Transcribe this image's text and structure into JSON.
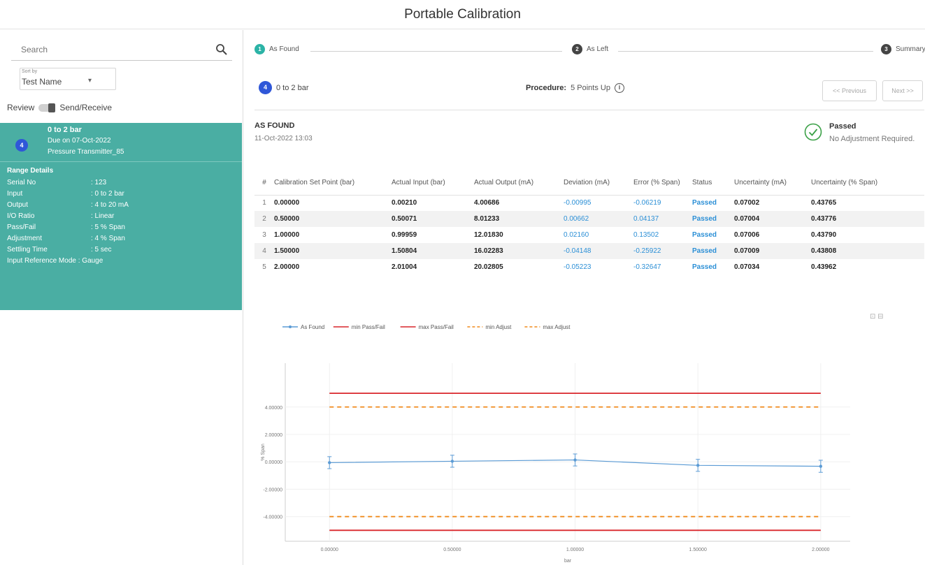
{
  "app_title": "Portable Calibration",
  "sidebar": {
    "search_placeholder": "Search",
    "sort": {
      "caption": "Sort by",
      "value": "Test Name"
    },
    "review": {
      "left": "Review",
      "right": "Send/Receive"
    },
    "card": {
      "badge": "4",
      "title": "0 to 2 bar",
      "due": "Due on 07-Oct-2022",
      "type": "Pressure Transmitter_85",
      "range_title": "Range Details",
      "details": [
        {
          "k": "Serial No",
          "v": ": 123"
        },
        {
          "k": "Input",
          "v": ": 0 to 2 bar"
        },
        {
          "k": "Output",
          "v": ": 4 to 20 mA"
        },
        {
          "k": "I/O Ratio",
          "v": ": Linear"
        },
        {
          "k": "Pass/Fail",
          "v": ": 5 % Span"
        },
        {
          "k": "Adjustment",
          "v": ": 4 % Span"
        },
        {
          "k": "Settling Time",
          "v": ": 5 sec"
        }
      ],
      "ref_mode": "Input Reference Mode : Gauge"
    }
  },
  "stepper": {
    "steps": [
      {
        "num": "1",
        "label": "As Found",
        "color": "#2bb3a6"
      },
      {
        "num": "2",
        "label": "As Left",
        "color": "#444444"
      },
      {
        "num": "3",
        "label": "Summary",
        "color": "#444444"
      }
    ]
  },
  "subheader": {
    "badge": "4",
    "range": "0 to 2 bar",
    "procedure_label": "Procedure:",
    "procedure_value": "5 Points Up",
    "prev_label": "<< Previous",
    "next_label": "Next >>"
  },
  "result": {
    "title": "AS FOUND",
    "date": "11-Oct-2022 13:03",
    "status": "Passed",
    "status_note": "No Adjustment Required."
  },
  "table": {
    "headers": [
      "#",
      "Calibration Set Point (bar)",
      "Actual Input (bar)",
      "Actual Output (mA)",
      "Deviation (mA)",
      "Error (% Span)",
      "Status",
      "Uncertainty (mA)",
      "Uncertainty (% Span)"
    ],
    "rows": [
      [
        "1",
        "0.00000",
        "0.00210",
        "4.00686",
        "-0.00995",
        "-0.06219",
        "Passed",
        "0.07002",
        "0.43765"
      ],
      [
        "2",
        "0.50000",
        "0.50071",
        "8.01233",
        "0.00662",
        "0.04137",
        "Passed",
        "0.07004",
        "0.43776"
      ],
      [
        "3",
        "1.00000",
        "0.99959",
        "12.01830",
        "0.02160",
        "0.13502",
        "Passed",
        "0.07006",
        "0.43790"
      ],
      [
        "4",
        "1.50000",
        "1.50804",
        "16.02283",
        "-0.04148",
        "-0.25922",
        "Passed",
        "0.07009",
        "0.43808"
      ],
      [
        "5",
        "2.00000",
        "2.01004",
        "20.02805",
        "-0.05223",
        "-0.32647",
        "Passed",
        "0.07034",
        "0.43962"
      ]
    ]
  },
  "chart_data": {
    "type": "line",
    "xlabel": "bar",
    "ylabel": "% Span",
    "x": [
      0,
      0.5,
      1,
      1.5,
      2
    ],
    "x_ticks": [
      "0.00000",
      "0.50000",
      "1.00000",
      "1.50000",
      "2.00000"
    ],
    "y_ticks": [
      "4.00000",
      "2.00000",
      "0.00000",
      "-2.00000",
      "-4.00000"
    ],
    "ylim": [
      -5.8,
      7.2
    ],
    "legend_position": "top-left",
    "series": [
      {
        "name": "As Found",
        "values": [
          -0.06219,
          0.04137,
          0.13502,
          -0.25922,
          -0.32647
        ],
        "error": [
          0.43765,
          0.43776,
          0.4379,
          0.43808,
          0.43962
        ],
        "color": "#5b9bd5",
        "style": "solid-markers"
      },
      {
        "name": "min Pass/Fail",
        "values": [
          -5,
          -5,
          -5,
          -5,
          -5
        ],
        "color": "#d9262b",
        "style": "solid"
      },
      {
        "name": "max Pass/Fail",
        "values": [
          5,
          5,
          5,
          5,
          5
        ],
        "color": "#d9262b",
        "style": "solid"
      },
      {
        "name": "min Adjust",
        "values": [
          -4,
          -4,
          -4,
          -4,
          -4
        ],
        "color": "#f08a1c",
        "style": "dashed"
      },
      {
        "name": "max Adjust",
        "values": [
          4,
          4,
          4,
          4,
          4
        ],
        "color": "#f08a1c",
        "style": "dashed"
      }
    ]
  }
}
